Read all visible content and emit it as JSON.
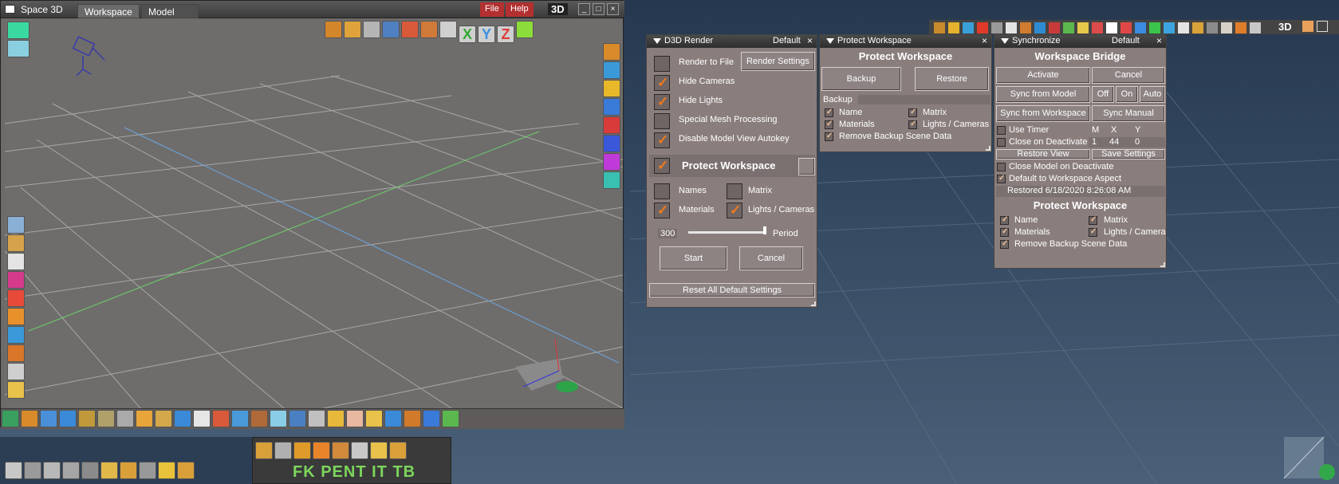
{
  "main_window": {
    "title": "Space 3D",
    "tabs": [
      "Workspace",
      "Model"
    ],
    "menus": [
      "File",
      "Help"
    ],
    "mode_label": "3D"
  },
  "right_toolbar": {
    "mode_label": "3D"
  },
  "render_panel": {
    "title": "D3D Render",
    "preset": "Default",
    "options": [
      {
        "label": "Render to File",
        "checked": false
      },
      {
        "label": "Hide Cameras",
        "checked": true
      },
      {
        "label": "Hide Lights",
        "checked": true
      },
      {
        "label": "Special Mesh Processing",
        "checked": false
      },
      {
        "label": "Disable Model View Autokey",
        "checked": true
      }
    ],
    "render_settings_button": "Render Settings",
    "protect_workspace": {
      "label": "Protect Workspace",
      "checked": true
    },
    "protect_options": [
      {
        "label": "Names",
        "checked": false
      },
      {
        "label": "Matrix",
        "checked": false
      },
      {
        "label": "Materials",
        "checked": true
      },
      {
        "label": "Lights / Cameras",
        "checked": true
      }
    ],
    "period": {
      "value": "300",
      "label": "Period",
      "level": 1.0
    },
    "start_button": "Start",
    "cancel_button": "Cancel",
    "reset_button": "Reset All Default Settings"
  },
  "protect_panel": {
    "title": "Protect Workspace",
    "header": "Protect Workspace",
    "backup_button": "Backup",
    "restore_button": "Restore",
    "backup_label": "Backup",
    "options": [
      {
        "label": "Name",
        "checked": true
      },
      {
        "label": "Matrix",
        "checked": true
      },
      {
        "label": "Materials",
        "checked": true
      },
      {
        "label": "Lights / Cameras",
        "checked": true
      }
    ],
    "remove_backup": {
      "label": "Remove Backup Scene Data",
      "checked": true
    }
  },
  "sync_panel": {
    "title": "Synchronize",
    "preset": "Default",
    "header": "Workspace Bridge",
    "activate_button": "Activate",
    "cancel_button": "Cancel",
    "sync_from_model": "Sync from Model",
    "off_button": "Off",
    "on_button": "On",
    "auto_button": "Auto",
    "sync_from_workspace": "Sync from Workspace",
    "sync_manual": "Sync Manual",
    "use_timer": {
      "label": "Use Timer",
      "checked": false
    },
    "timer_headers": [
      "M",
      "X",
      "Y"
    ],
    "close_on_deactivate": {
      "label": "Close on Deactivate",
      "checked": false
    },
    "timer_values": [
      "1",
      "44",
      "0"
    ],
    "restore_view": "Restore View",
    "save_settings": "Save Settings",
    "close_model": {
      "label": "Close Model on Deactivate",
      "checked": false
    },
    "default_aspect": {
      "label": "Default to Workspace Aspect",
      "checked": true
    },
    "restored_status": "Restored 6/18/2020  8:26:08 AM",
    "protect_header": "Protect Workspace",
    "options": [
      {
        "label": "Name",
        "checked": true
      },
      {
        "label": "Matrix",
        "checked": true
      },
      {
        "label": "Materials",
        "checked": true
      },
      {
        "label": "Lights / Cameras",
        "checked": true
      }
    ],
    "remove_backup": {
      "label": "Remove Backup Scene Data",
      "checked": true
    }
  },
  "palette": {
    "row1_letters": "FK PENT IT TB"
  }
}
